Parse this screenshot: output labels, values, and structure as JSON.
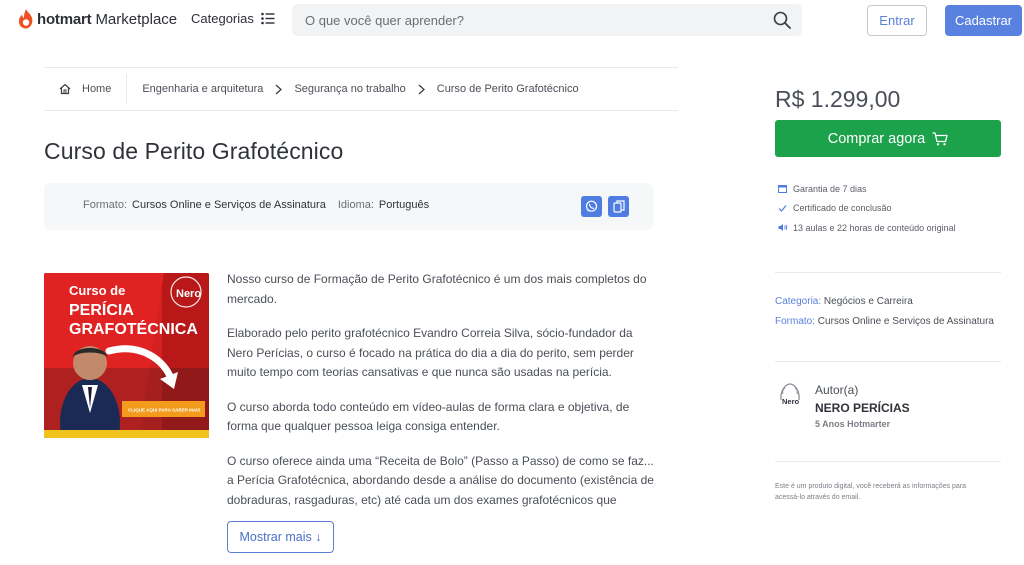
{
  "header": {
    "logo_brand": "hotmart",
    "logo_market": "Marketplace",
    "categorias_label": "Categorias",
    "search_placeholder": "O que você quer aprender?",
    "entrar_label": "Entrar",
    "cadastrar_label": "Cadastrar"
  },
  "breadcrumb": {
    "home": "Home",
    "items": [
      "Engenharia e arquitetura",
      "Segurança no trabalho",
      "Curso de Perito Grafotécnico"
    ]
  },
  "course": {
    "title": "Curso de Perito Grafotécnico",
    "format_label": "Formato:",
    "format_value": "Cursos Online e Serviços de Assinatura",
    "language_label": "Idioma:",
    "language_value": "Português",
    "image": {
      "line1": "Curso de",
      "line2": "PERÍCIA",
      "line3": "GRAFOTÉCNICA",
      "badge": "Nero",
      "cta": "CLIQUE AQUI PARA SABER MAIS"
    },
    "description": [
      "Nosso curso de Formação de Perito Grafotécnico é um dos mais completos do mercado.",
      "Elaborado pelo perito grafotécnico Evandro Correia Silva, sócio-fundador da Nero Perícias, o curso é focado na prática do dia a dia do perito, sem perder muito tempo com teorias cansativas e que nunca são usadas na perícia.",
      "O curso aborda todo conteúdo em vídeo-aulas de forma clara e objetiva, de forma que qualquer pessoa leiga consiga entender.",
      "O curso oferece ainda uma “Receita de Bolo” (Passo a Passo) de como se faz... a Perícia Grafotécnica, abordando desde a análise do documento (existência de dobraduras, rasgaduras, etc) até cada um dos exames grafotécnicos que"
    ],
    "show_more": "Mostrar mais ↓"
  },
  "sidebar": {
    "price": "R$ 1.299,00",
    "buy_label": "Comprar agora",
    "features": [
      "Garantia de 7 dias",
      "Certificado de conclusão",
      "13 aulas e 22 horas de conteúdo original"
    ],
    "category_label": "Categoria:",
    "category_value": "Negócios e Carreira",
    "format_label": "Formato:",
    "format_value": "Cursos Online e Serviços de Assinatura",
    "author_label": "Autor(a)",
    "author_name": "NERO PERÍCIAS",
    "author_years": "5 Anos Hotmarter",
    "avatar_text": "Nero",
    "disclaimer": "Este é um produto digital, você receberá as informações para acessá-lo através do email."
  },
  "colors": {
    "accent_blue": "#5981e0",
    "buy_green": "#1ba24a",
    "brand_orange": "#f04e23"
  }
}
